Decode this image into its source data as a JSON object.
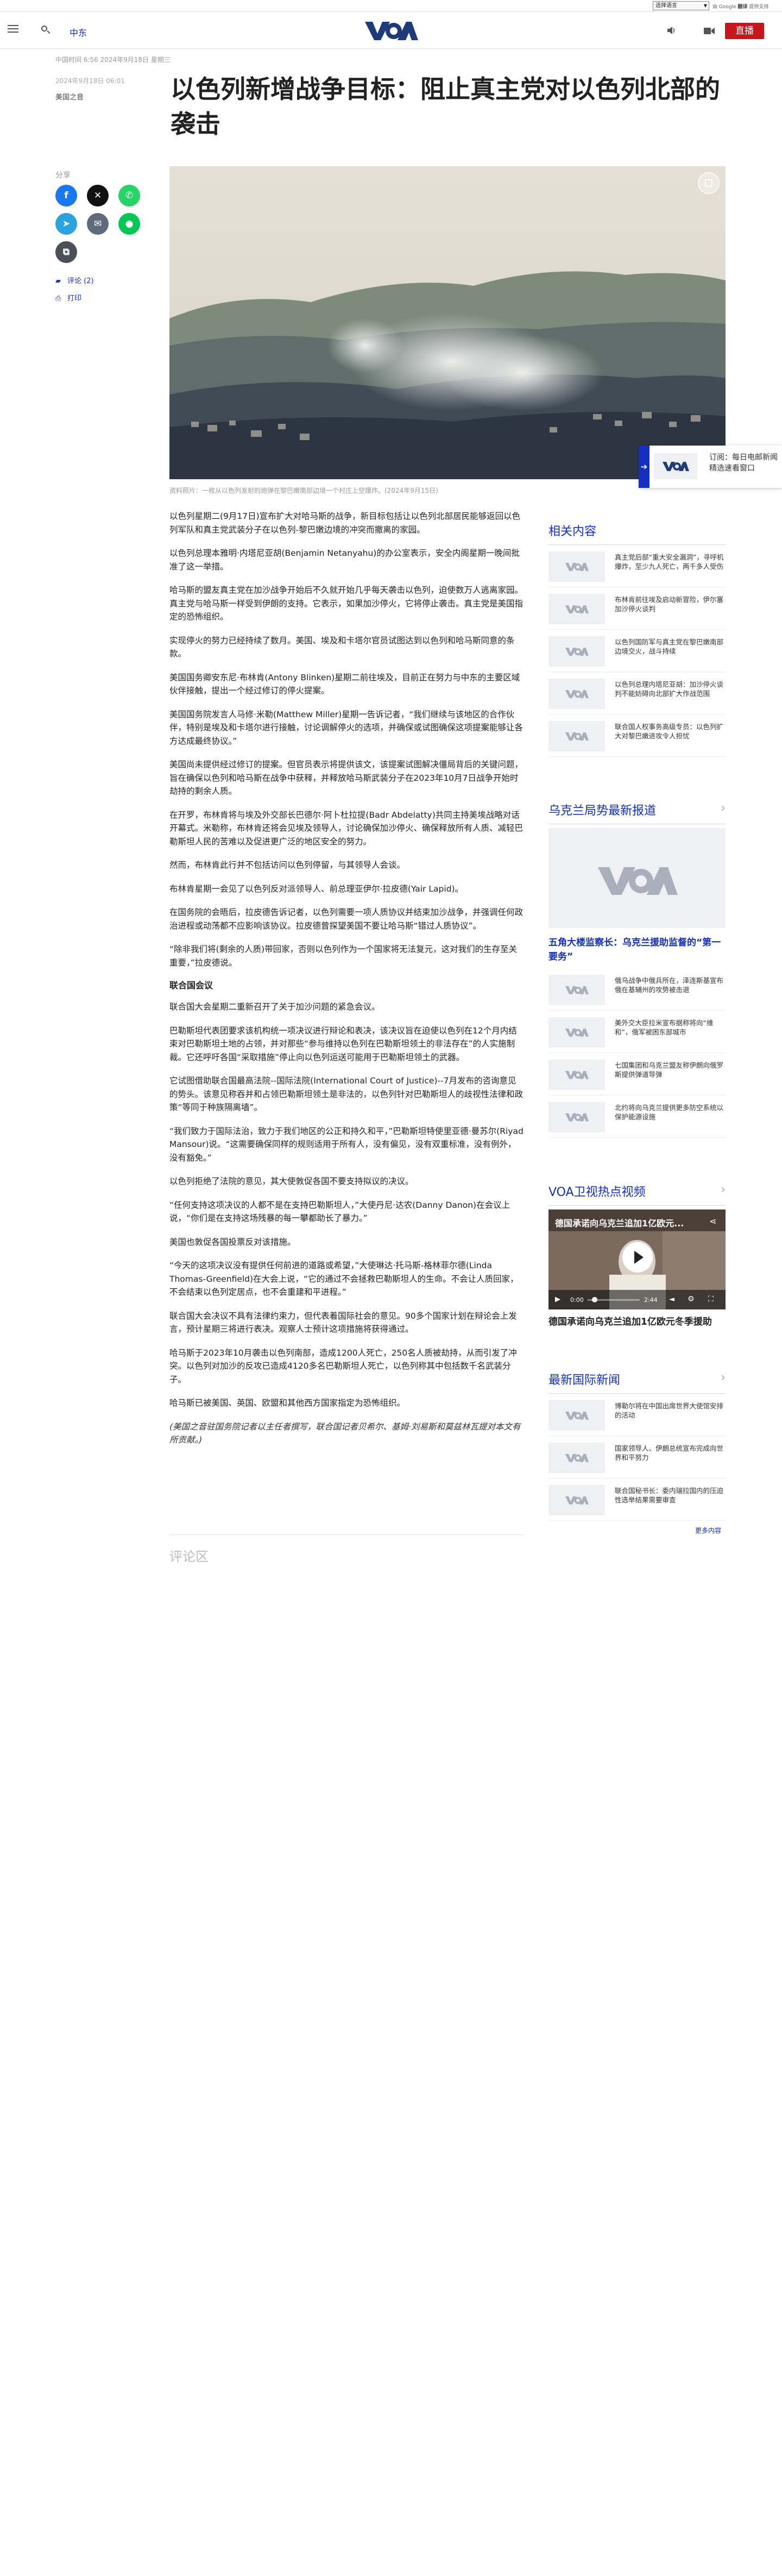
{
  "translate": {
    "select_label": "选择语言",
    "powered_by": "由 Google",
    "brand": "翻译",
    "suffix": "提供支持"
  },
  "header": {
    "lang_link": "中东",
    "live_label": "直播",
    "logo_text": "VOA"
  },
  "article": {
    "meta_line": "中国时间 6:56 2024年9月18日 星期三",
    "date": "2024年9月18日 06:01",
    "byline": "美国之音",
    "title": "以色列新增战争目标：阻止真主党对以色列北部的袭击",
    "share_label": "分享",
    "comments_link": "评论 (2)",
    "print_link": "打印",
    "caption": "资料照片：一枚从以色列发射的炮弹在黎巴嫩南部边境一个村庄上空爆炸。(2024年9月15日)",
    "paragraphs": [
      "以色列星期二(9月17日)宣布扩大对哈马斯的战争，新目标包括让以色列北部居民能够返回以色列军队和真主党武装分子在以色列-黎巴嫩边境的冲突而撤离的家园。",
      "以色列总理本雅明·内塔尼亚胡(Benjamin Netanyahu)的办公室表示，安全内阁星期一晚间批准了这一举措。",
      "哈马斯的盟友真主党在加沙战争开始后不久就开始几乎每天袭击以色列，迫使数万人逃离家园。真主党与哈马斯一样受到伊朗的支持。它表示，如果加沙停火，它将停止袭击。真主党是美国指定的恐怖组织。",
      "实现停火的努力已经持续了数月。美国、埃及和卡塔尔官员试图达到以色列和哈马斯同意的条款。",
      "美国国务卿安东尼·布林肯(Antony Blinken)星期二前往埃及，目前正在努力与中东的主要区域伙伴接触，提出一个经过修订的停火提案。",
      "美国国务院发言人马修·米勒(Matthew Miller)星期一告诉记者，“我们继续与该地区的合作伙伴，特别是埃及和卡塔尔进行接触，讨论调解停火的选项，并确保或试图确保这项提案能够让各方达成最终协议。”",
      "美国尚未提供经过修订的提案。但官员表示将提供该文，该提案试图解决僵局背后的关键问题，旨在确保以色列和哈马斯在战争中获释，并释放哈马斯武装分子在2023年10月7日战争开始时劫持的剩余人质。",
      "在开罗，布林肯将与埃及外交部长巴德尔·阿卜杜拉提(Badr Abdelatty)共同主持美埃战略对话开幕式。米勒称，布林肯还将会见埃及领导人，讨论确保加沙停火、确保释放所有人质、减轻巴勒斯坦人民的苦难以及促进更广泛的地区安全的努力。",
      "然而，布林肯此行并不包括访问以色列停留，与其领导人会谈。",
      "布林肯星期一会见了以色列反对派领导人、前总理亚伊尔·拉皮德(Yair Lapid)。",
      "在国务院的会晤后，拉皮德告诉记者，以色列需要一项人质协议并结束加沙战争，并强调任何政治进程或动荡都不应影响该协议。拉皮德曾探望美国不要让哈马斯“错过人质协议”。",
      "“除非我们将(剩余的人质)带回家，否则以色列作为一个国家将无法复元，这对我们的生存至关重要，”拉皮德说。",
      "联合国会议",
      "联合国大会星期二重新召开了关于加沙问题的紧急会议。",
      "巴勒斯坦代表团要求该机构统一项决议进行辩论和表决，该决议旨在迫使以色列在12个月内结束对巴勒斯坦土地的占领，并对那些“参与维持以色列在巴勒斯坦领土的非法存在”的人实施制裁。它还呼吁各国“采取措施”停止向以色列运送可能用于巴勒斯坦领土的武器。",
      "它试图借助联合国最高法院--国际法院(International Court of Justice)--7月发布的咨询意见的势头。该意见称吞并和占领巴勒斯坦领土是非法的，以色列针对巴勒斯坦人的歧视性法律和政策“等同于种族隔离墙”。",
      "“我们致力于国际法治，致力于我们地区的公正和持久和平，”巴勒斯坦特使里亚德·曼苏尔(Riyad Mansour)说。“这需要确保同样的规则适用于所有人，没有偏见，没有双重标准，没有例外，没有豁免。”",
      "以色列拒绝了法院的意见，其大使敦促各国不要支持拟议的决议。",
      "“任何支持这项决议的人都不是在支持巴勒斯坦人，”大使丹尼·达农(Danny Danon)在会议上说，“你们是在支持这场残暴的每一攀都助长了暴力。”",
      "美国也敦促各国投票反对该措施。",
      "“今天的这项决议没有提供任何前进的道路或希望，”大使琳达·托马斯-格林菲尔德(Linda Thomas-Greenfield)在大会上说，“它的通过不会拯救巴勒斯坦人的生命。不会让人质回家，不会结束以色列定居点，也不会重建和平进程。”",
      "联合国大会决议不具有法律约束力，但代表着国际社会的意见。90多个国家计划在辩论会上发言，预计星期三将进行表决。观察人士预计这项措施将获得通过。",
      "哈马斯于2023年10月袭击以色列南部，造成1200人死亡，250名人质被劫持，从而引发了冲突。以色列对加沙的反攻已造成4120多名巴勒斯坦人死亡，以色列称其中包括数千名武装分子。",
      "哈马斯已被美国、英国、欧盟和其他西方国家指定为恐怖组织。",
      "(美国之音驻国务院记者以主任者撰写，联合国记者贝希尔、基姆·刘易斯和莫兹林瓦提对本文有所贡献。)"
    ],
    "comments_title": "评论区"
  },
  "float_card": {
    "text": "订阅：每日电邮新闻精选速看窗口"
  },
  "related": {
    "title": "相关内容",
    "items": [
      "真主党后部“重大安全漏洞”，寻呼机爆炸，至少九人死亡，两千多人受伤",
      "布林肯前往埃及启动新冒险，伊尔塞加沙停火谈判",
      "以色列国防军与真主党在黎巴嫩南部边境交火，战斗持续",
      "以色列总理内塔尼亚胡：加沙停火谈判不能妨碍向北部扩大作战范围",
      "联合国人权事务高级专员：以色列扩大对黎巴嫩进攻令人担忧"
    ]
  },
  "ukraine": {
    "title": "乌克兰局势最新报道",
    "lead_title": "五角大楼监察长：乌克兰援助监督的“第一要务”",
    "items": [
      "俄乌战争中俄兵所在，泽连斯基宣布俄在基辅州的攻势被击退",
      "美外交大臣拉米宣布据称将向“维和”，俄军被困东部城市",
      "七国集团和乌克兰盟友称伊朗向俄罗斯提供弹道导弹",
      "北约将向乌克兰提供更多防空系统以保护能源设施"
    ]
  },
  "video_section": {
    "title": "VOA卫视热点视频",
    "video_title": "德国承诺向乌克兰追加1亿欧元...",
    "time_current": "0:00",
    "time_total": "2:44",
    "caption": "德国承诺向乌克兰追加1亿欧元冬季援助"
  },
  "intl": {
    "title": "最新国际新闻",
    "items": [
      "博勒尔将在中国出席世界大使馆安排的活动",
      "国家领导人、伊朗总统宣布完成向世界和平努力",
      "联合国秘书长：委内瑞拉国内的压迫性选举结果需要审查"
    ],
    "more": "更多内容"
  },
  "colors": {
    "brand_blue": "#1330bf",
    "live_red": "#c4161c",
    "logo_blue": "#1e3a78"
  }
}
